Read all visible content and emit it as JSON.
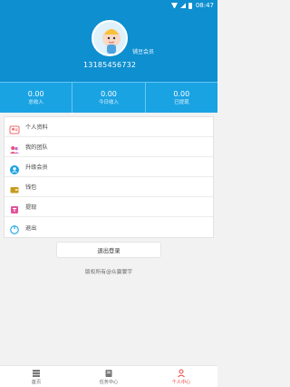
{
  "status_bar": {
    "time": "08:47"
  },
  "profile": {
    "member_tag": "铺豆会员",
    "phone": "13185456732"
  },
  "stats": [
    {
      "value": "0.00",
      "label": "总收入"
    },
    {
      "value": "0.00",
      "label": "今日收入"
    },
    {
      "value": "0.00",
      "label": "已提现"
    }
  ],
  "menu": {
    "items": [
      {
        "label": "个人资料"
      },
      {
        "label": "我的团队"
      },
      {
        "label": "升级会员"
      },
      {
        "label": "钱包"
      },
      {
        "label": "提现"
      },
      {
        "label": "退出"
      }
    ]
  },
  "logout_label": "退出登录",
  "copyright": "版权所有@众赢寰宇",
  "tabs": [
    {
      "label": "首页"
    },
    {
      "label": "任务中心"
    },
    {
      "label": "个人中心"
    }
  ],
  "colors": {
    "header": "#0d8fd0",
    "stats": "#1aa3e3",
    "active_tab": "#ea4a44"
  }
}
